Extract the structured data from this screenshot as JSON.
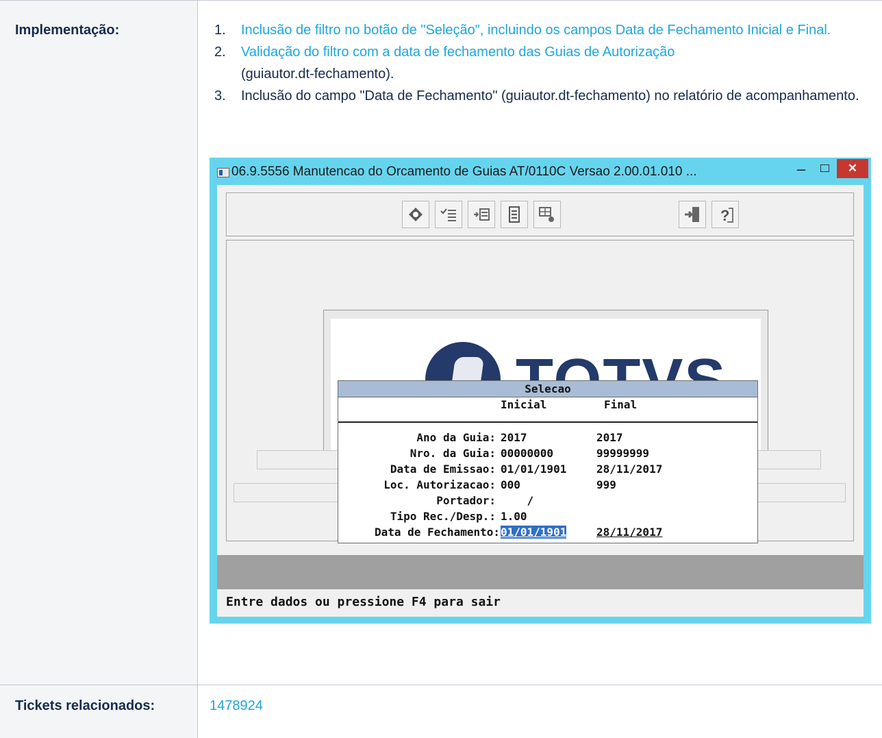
{
  "table": {
    "row1_header": "Implementação:",
    "row2_header": "Tickets relacionados:",
    "items": [
      {
        "num": "1.",
        "text": "Inclusão de filtro no botão de \"Seleção\", incluindo os campos Data de Fechamento Inicial e Final.",
        "style": "link"
      },
      {
        "num": "2.",
        "text_link": "Validação do filtro com a data de fechamento das Guias de Autorização",
        "text_plain": "(guiautor.dt-fechamento).",
        "style": "mixed"
      },
      {
        "num": "3.",
        "text": "Inclusão do campo \"Data de Fechamento\" (guiautor.dt-fechamento) no relatório de acompanhamento.",
        "style": "plain"
      }
    ],
    "ticket": "1478924"
  },
  "window": {
    "title": "06.9.5556 Manutencao do Orcamento de Guias AT/0110C Versao 2.00.01.010 ...",
    "minimize": "–",
    "close": "✕",
    "logo_text": "TOTVS",
    "status": "Entre dados ou pressione F4 para sair",
    "toolbar_icons": [
      "tag-icon",
      "checklist-icon",
      "list-arrow-icon",
      "document-icon",
      "grid-settings-icon",
      "exit-door-icon",
      "help-icon"
    ]
  },
  "dialog": {
    "title": "Selecao",
    "col_inicial": "Inicial",
    "col_final": "Final",
    "rows": [
      {
        "label": "Ano da Guia:",
        "inicial": "2017",
        "final": "2017"
      },
      {
        "label": "Nro. da Guia:",
        "inicial": "00000000",
        "final": "99999999"
      },
      {
        "label": "Data de Emissao:",
        "inicial": "01/01/1901",
        "final": "28/11/2017"
      },
      {
        "label": "Loc. Autorizacao:",
        "inicial": "000",
        "final": "999"
      },
      {
        "label": "Portador:",
        "inicial": "    /",
        "final": ""
      },
      {
        "label": "Tipo Rec./Desp.:",
        "inicial": "1.00",
        "final": ""
      },
      {
        "label": "Data de Fechamento:",
        "inicial": "01/01/1901",
        "final": "28/11/2017"
      }
    ]
  }
}
